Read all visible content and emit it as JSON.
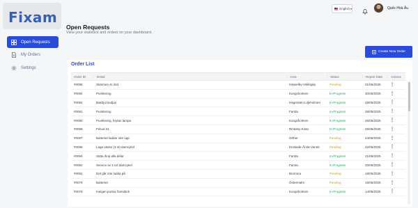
{
  "app": {
    "logo_text": "Fixam"
  },
  "sidebar": {
    "items": [
      {
        "label": "Open Requests",
        "icon": "grid-icon",
        "active": true
      },
      {
        "label": "My Orders",
        "icon": "document-icon",
        "active": false
      },
      {
        "label": "Settings",
        "icon": "gear-icon",
        "active": false
      }
    ]
  },
  "topbar": {
    "language": "English",
    "user_name": "Quốc Hoà Âu"
  },
  "header": {
    "title": "Open Requests",
    "subtitle": "View your statistics and orders on your dashboard."
  },
  "actions": {
    "create_label": "Create New Order"
  },
  "orders": {
    "title": "Order List",
    "columns": [
      "Order ID",
      "Detail",
      "Area",
      "Status",
      "Repair Date",
      "Actions"
    ],
    "rows": [
      {
        "id": "#0096",
        "detail": "Skärmen är död",
        "area": "Hässelby-Vällingby",
        "status": "Pending",
        "date": "01/06/2025"
      },
      {
        "id": "#0094",
        "detail": "Punktering",
        "area": "Kungsholmen",
        "status": "In-Progress",
        "date": "30/05/2025"
      },
      {
        "id": "#0092",
        "detail": "Bakhjul kedjan",
        "area": "Hägersten-Liljeholmen",
        "status": "In-Progress",
        "date": "29/05/2025"
      },
      {
        "id": "#0091",
        "detail": "Punktering",
        "area": "Farsta",
        "status": "In-Progress",
        "date": "28/05/2025"
      },
      {
        "id": "#0090",
        "detail": "Punktering, brytan lampa",
        "area": "Kungsholmen",
        "status": "In-Progress",
        "date": "26/05/2025"
      },
      {
        "id": "#0099",
        "detail": "Fekod 21",
        "area": "Rinkeby-Kista",
        "status": "In-Progress",
        "date": "26/05/2025"
      },
      {
        "id": "#0087",
        "detail": "Batteriet laddar inte upp",
        "area": "Orther",
        "status": "Pending",
        "date": "24/05/2025"
      },
      {
        "id": "#0085",
        "detail": "Laga växlar (3 st) damcykel",
        "area": "Enskede-Årsta-Vantör",
        "status": "Pending",
        "date": "22/05/2025"
      },
      {
        "id": "#0084",
        "detail": "Sätta ihop alla delar",
        "area": "Farsta",
        "status": "In-Progress",
        "date": "21/05/2025"
      },
      {
        "id": "#0082",
        "detail": "Service av 2 vxl damcykel",
        "area": "Farsta",
        "status": "In-Progress",
        "date": "20/05/2025"
      },
      {
        "id": "#0081",
        "detail": "Det går inte ladda på",
        "area": "Bromma",
        "status": "Pending",
        "date": "18/05/2025"
      },
      {
        "id": "#0079",
        "detail": "Batteriet",
        "area": "Östermalm",
        "status": "Pending",
        "date": "16/05/2025"
      },
      {
        "id": "#0078",
        "detail": "Ineigen punka framdäck",
        "area": "Kungsholmen",
        "status": "In-Progress",
        "date": "14/05/2025"
      }
    ]
  },
  "colors": {
    "accent": "#2a4bd7",
    "pending": "#d4a017",
    "in_progress": "#22a55a"
  }
}
